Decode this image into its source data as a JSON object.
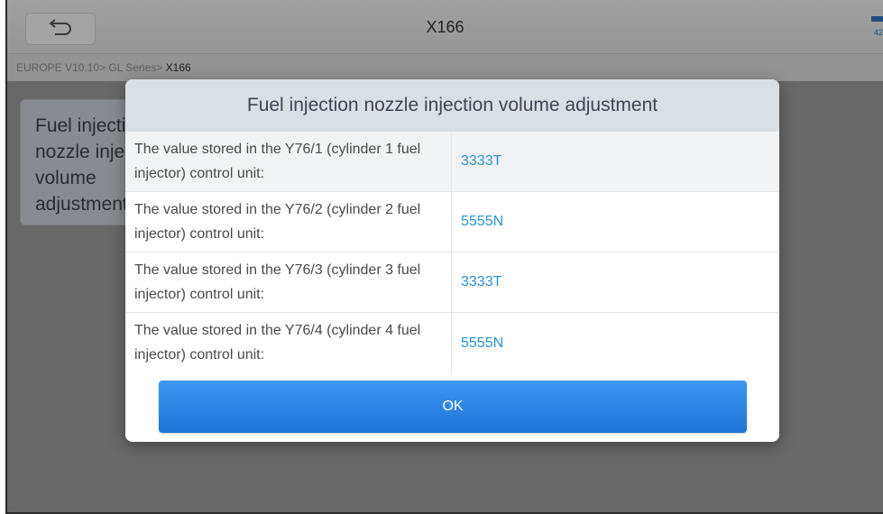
{
  "header": {
    "title": "X166",
    "right_indicator": "42"
  },
  "breadcrumb": {
    "path": "EUROPE V10.10> GL Series> ",
    "current": "X166"
  },
  "function_card": {
    "label": "Fuel injection nozzle injection volume adjustment"
  },
  "dialog": {
    "title": "Fuel injection nozzle injection volume adjustment",
    "rows": [
      {
        "label": "The value stored in the Y76/1 (cylinder 1 fuel injector) control unit:",
        "value": "3333T"
      },
      {
        "label": "The value stored in the Y76/2 (cylinder 2 fuel injector) control unit:",
        "value": "5555N"
      },
      {
        "label": "The value stored in the Y76/3 (cylinder 3 fuel injector) control unit:",
        "value": "3333T"
      },
      {
        "label": "The value stored in the Y76/4 (cylinder 4 fuel injector) control unit:",
        "value": "5555N"
      }
    ],
    "ok_label": "OK"
  },
  "colors": {
    "accent": "#1f74d8",
    "value_text": "#2b93cf"
  }
}
